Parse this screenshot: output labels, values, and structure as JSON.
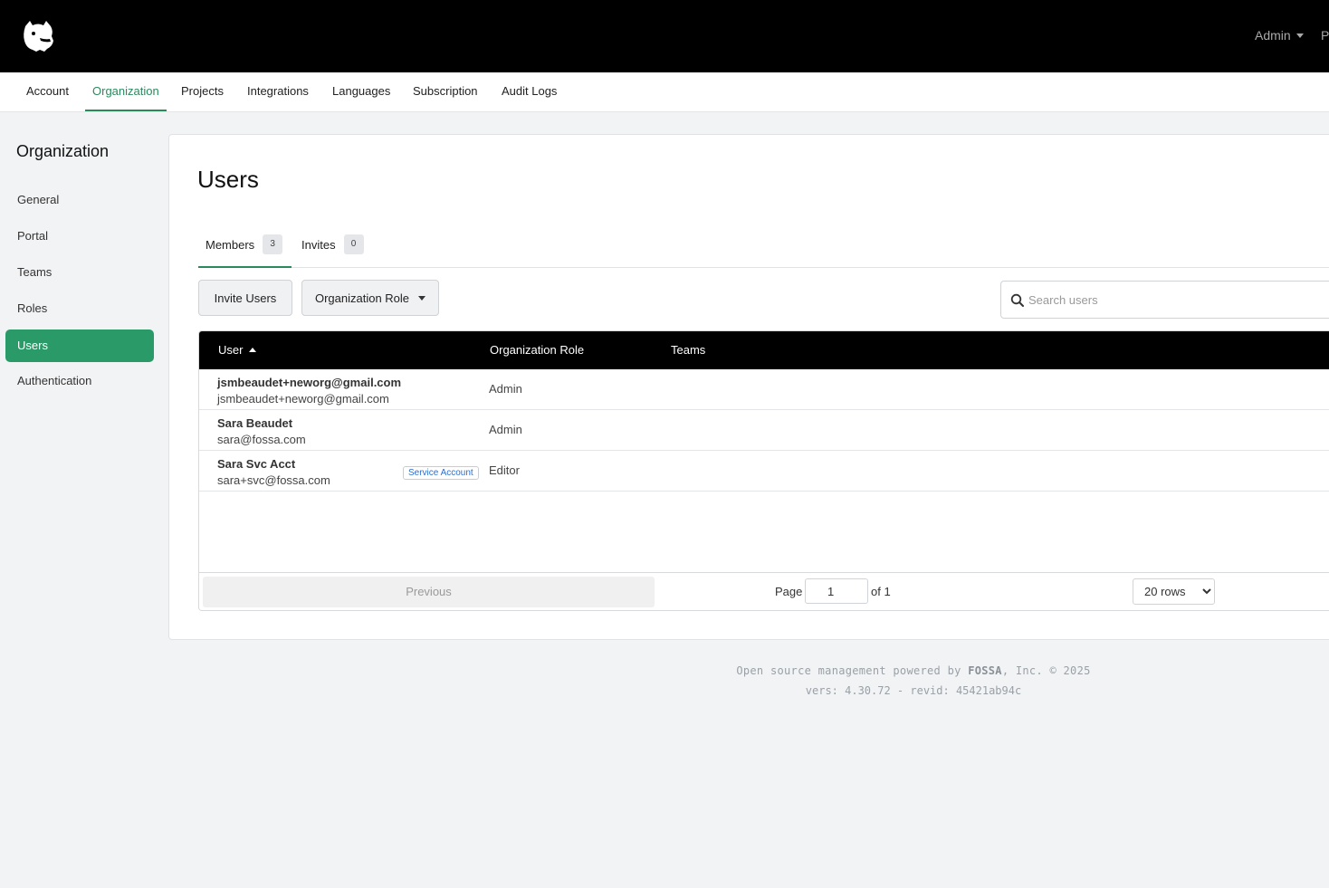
{
  "header": {
    "logo_name": "fossa-logo",
    "user_menu_label": "Admin",
    "extra_menu_label": "P"
  },
  "nav": {
    "tabs": [
      {
        "label": "Account"
      },
      {
        "label": "Organization",
        "active": true
      },
      {
        "label": "Projects"
      },
      {
        "label": "Integrations"
      },
      {
        "label": "Languages"
      },
      {
        "label": "Subscription"
      },
      {
        "label": "Audit Logs"
      }
    ]
  },
  "sidebar": {
    "title": "Organization",
    "items": [
      {
        "label": "General"
      },
      {
        "label": "Portal"
      },
      {
        "label": "Teams"
      },
      {
        "label": "Roles"
      },
      {
        "label": "Users",
        "active": true
      },
      {
        "label": "Authentication"
      }
    ]
  },
  "main": {
    "title": "Users",
    "tabs": [
      {
        "label": "Members",
        "count": "3",
        "active": true
      },
      {
        "label": "Invites",
        "count": "0"
      }
    ],
    "invite_button": "Invite Users",
    "role_filter_button": "Organization Role",
    "search_placeholder": "Search users"
  },
  "table": {
    "columns": [
      "User",
      "Organization Role",
      "Teams"
    ],
    "sorted_column": "User",
    "sort_direction": "ascending",
    "rows": [
      {
        "name": "jsmbeaudet+neworg@gmail.com",
        "email": "jsmbeaudet+neworg@gmail.com",
        "role": "Admin",
        "badge": ""
      },
      {
        "name": "Sara Beaudet",
        "email": "sara@fossa.com",
        "role": "Admin",
        "badge": ""
      },
      {
        "name": "Sara Svc Acct",
        "email": "sara+svc@fossa.com",
        "role": "Editor",
        "badge": "Service Account"
      }
    ]
  },
  "pagination": {
    "previous_label": "Previous",
    "page_label": "Page",
    "current_page": "1",
    "of_label": "of 1",
    "rows_option": "20 rows"
  },
  "footer": {
    "line1_prefix": "Open source management powered by ",
    "line1_brand": "FOSSA",
    "line1_suffix": ", Inc. © 2025",
    "line2": "vers: 4.30.72 - revid: 45421ab94c"
  },
  "colors": {
    "accent": "#2a9a68",
    "topbar": "#000000",
    "background": "#f2f3f5"
  }
}
